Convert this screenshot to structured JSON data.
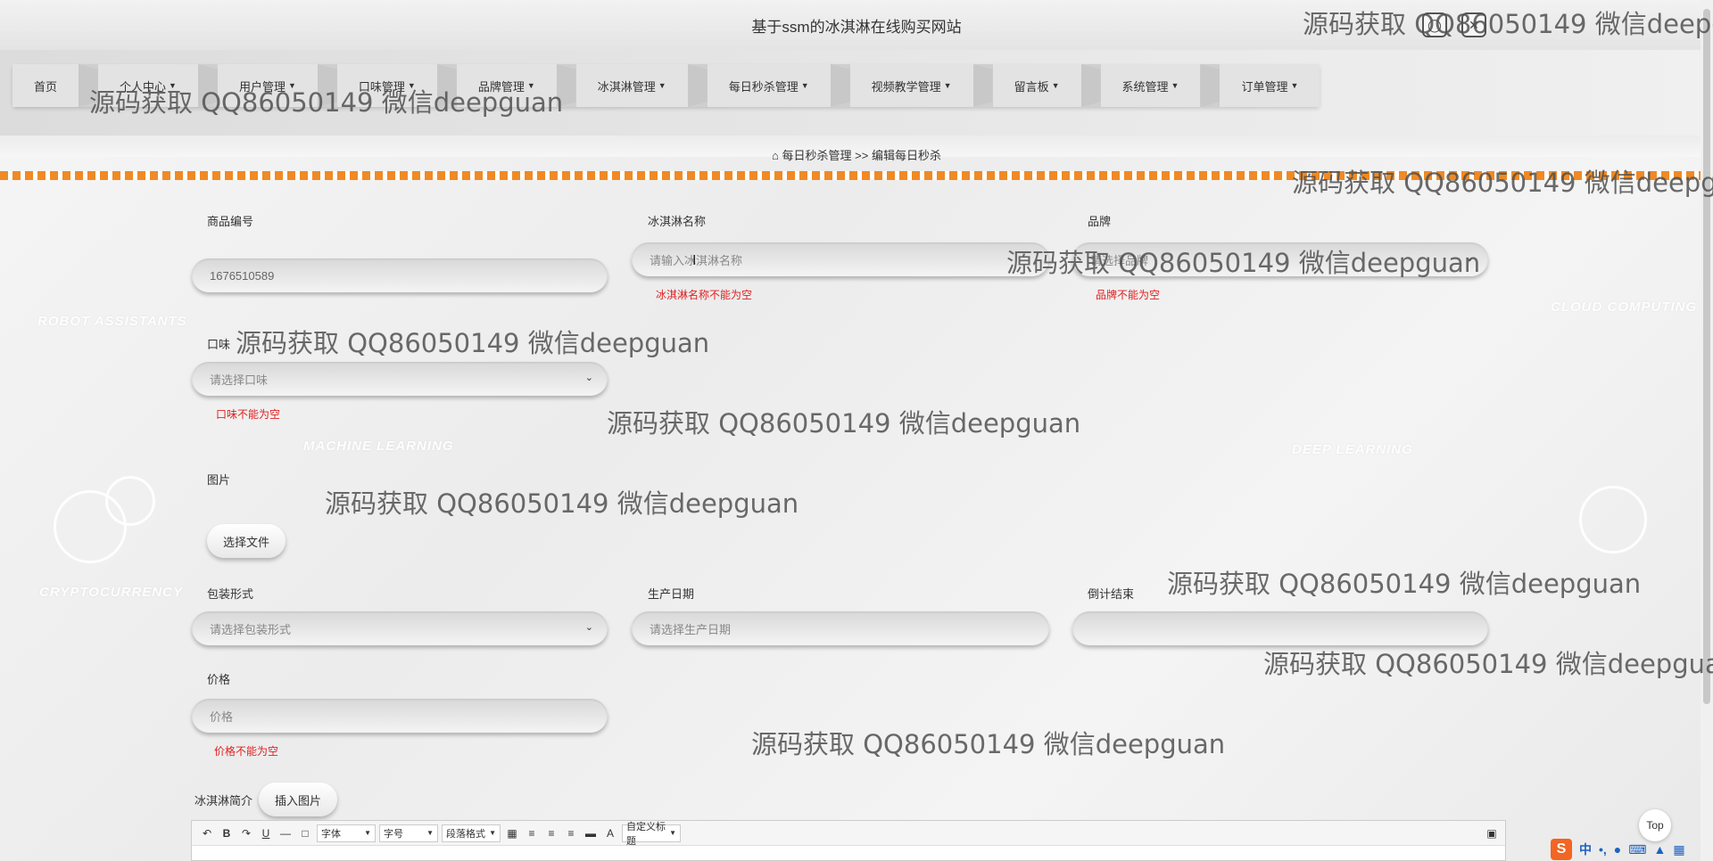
{
  "header": {
    "site_title": "基于ssm的冰淇淋在线购买网站",
    "user_icon": "user-icon",
    "close_icon": "close-icon"
  },
  "nav": {
    "items": [
      {
        "label": "首页",
        "dropdown": false
      },
      {
        "label": "个人中心",
        "dropdown": true
      },
      {
        "label": "用户管理",
        "dropdown": true
      },
      {
        "label": "口味管理",
        "dropdown": true
      },
      {
        "label": "品牌管理",
        "dropdown": true
      },
      {
        "label": "冰淇淋管理",
        "dropdown": true
      },
      {
        "label": "每日秒杀管理",
        "dropdown": true
      },
      {
        "label": "视频教学管理",
        "dropdown": true
      },
      {
        "label": "留言板",
        "dropdown": true
      },
      {
        "label": "系统管理",
        "dropdown": true
      },
      {
        "label": "订单管理",
        "dropdown": true
      }
    ]
  },
  "breadcrumb": {
    "home_icon": "home-icon",
    "parent": "每日秒杀管理",
    "separator": ">>",
    "current": "编辑每日秒杀"
  },
  "background_labels": [
    "ROBOT ASSISTANTS",
    "MACHINE LEARNING",
    "CRYPTOCURRENCY",
    "CLOUD COMPUTING",
    "DEEP LEARNING"
  ],
  "form": {
    "product_no": {
      "label": "商品编号",
      "value": "1676510589"
    },
    "icecream_name": {
      "label": "冰淇淋名称",
      "placeholder": "请输入冰淇淋名称",
      "error": "冰淇淋名称不能为空"
    },
    "brand": {
      "label": "品牌",
      "placeholder": "请选择品牌",
      "error": "品牌不能为空"
    },
    "flavor": {
      "label": "口味",
      "placeholder": "请选择口味",
      "error": "口味不能为空"
    },
    "image": {
      "label": "图片",
      "button": "选择文件"
    },
    "packaging": {
      "label": "包装形式",
      "placeholder": "请选择包装形式"
    },
    "production_date": {
      "label": "生产日期",
      "placeholder": "请选择生产日期"
    },
    "countdown_end": {
      "label": "倒计结束",
      "value": ""
    },
    "price": {
      "label": "价格",
      "placeholder": "价格",
      "error": "价格不能为空"
    },
    "intro": {
      "label": "冰淇淋简介",
      "insert_button": "插入图片"
    }
  },
  "editor": {
    "font_family": "字体",
    "font_size": "字号",
    "paragraph": "段落格式",
    "custom_title": "自定义标题",
    "text_color_label": "A"
  },
  "misc": {
    "top_button": "Top",
    "ime": {
      "logo": "S",
      "lang": "中",
      "punct": "•,"
    }
  },
  "watermarks": [
    "源码获取 QQ86050149 微信deepguan",
    "源码获取 QQ86050149 微信deepguan",
    "源码获取 QQ86050149 微信deepguan",
    "源码获取 QQ86050149 微信deepguan",
    "源码获取 QQ86050149 微信deepguan",
    "源码获取 QQ86050149 微信deepguan",
    "源码获取 QQ86050149 微信deepguan",
    "源码获取 QQ86050149 微信deepguan",
    "源码获取 QQ86050149 微信deepguan",
    "源码获取 QQ86050149 微信deepguan"
  ]
}
